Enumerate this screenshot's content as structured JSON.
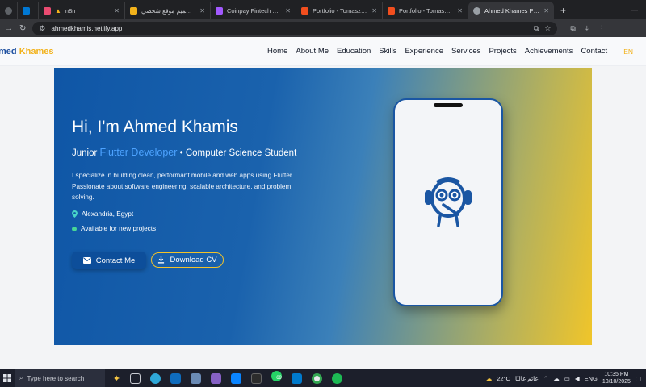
{
  "browser": {
    "tabs": [
      {
        "title": "",
        "color": "#5f6368"
      },
      {
        "title": "",
        "color": "#0078d4"
      },
      {
        "title": "n8n",
        "color": "#ea4b71"
      },
      {
        "title": "تصميم موقع شخصي -",
        "color": "#f2b21b"
      },
      {
        "title": "Coinpay Fintech Finan",
        "color": "#a259ff"
      },
      {
        "title": "Portfolio - Tomasz Gaj",
        "color": "#f24e1e"
      },
      {
        "title": "Portfolio - Tomasz Gaj",
        "color": "#f24e1e"
      },
      {
        "title": "Ahmed Khames Portfo",
        "color": "#9aa0a6",
        "active": true
      }
    ],
    "url": "ahmedkhamis.netlify.app"
  },
  "site": {
    "brand_part1": "med ",
    "brand_part2": "Khames",
    "nav": [
      "Home",
      "About Me",
      "Education",
      "Skills",
      "Experience",
      "Services",
      "Projects",
      "Achievements",
      "Contact"
    ],
    "lang": "EN"
  },
  "hero": {
    "greeting": "Hi, I'm Ahmed Khamis",
    "subtitle_pre": "Junior ",
    "subtitle_highlight": "Flutter Developer",
    "subtitle_post": " • Computer Science Student",
    "description": "I specialize in building clean, performant mobile and web apps using Flutter. Passionate about software engineering, scalable architecture, and problem solving.",
    "location": "Alexandria, Egypt",
    "availability": "Available for new projects",
    "contact_label": "Contact Me",
    "cv_label": "Download CV"
  },
  "taskbar": {
    "search_placeholder": "Type here to search",
    "whatsapp_badge": "69",
    "weather": "22°C",
    "weather_label": "عائم غالبًا",
    "lang": "ENG",
    "time": "10:35 PM",
    "date": "10/10/2025"
  },
  "colors": {
    "accent": "#1d4f9f",
    "brand_gold": "#f2b21b",
    "highlight": "#4da3ff"
  }
}
